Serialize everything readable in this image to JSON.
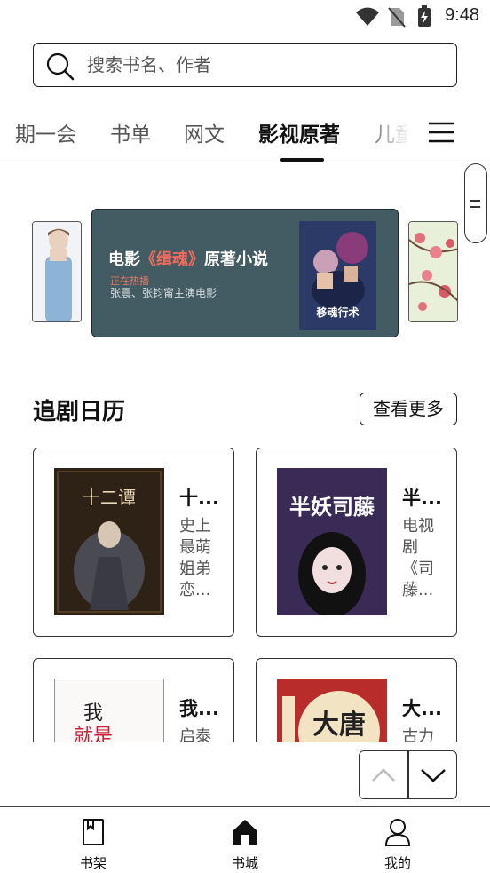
{
  "status_bar": {
    "time": "9:48",
    "icons": [
      "wifi-icon",
      "no-sim-icon",
      "battery-charging-icon"
    ]
  },
  "search": {
    "placeholder": "搜索书名、作者",
    "icon": "search-icon"
  },
  "tabs": [
    {
      "label": "期一会",
      "active": false
    },
    {
      "label": "书单",
      "active": false
    },
    {
      "label": "网文",
      "active": false
    },
    {
      "label": "影视原著",
      "active": true
    },
    {
      "label": "儿童",
      "active": false
    }
  ],
  "banner": {
    "title_prefix": "电影",
    "title_highlight": "《缉魂》",
    "title_suffix": "原著小说",
    "subtitle_1": "正在热播",
    "subtitle_2": "张震、张钧甯主演电影",
    "cover_title": "移魂行术",
    "highlight_color": "#f26b5b",
    "background_color": "#435b62"
  },
  "section": {
    "title": "追剧日历",
    "more_label": "查看更多"
  },
  "books": [
    {
      "title": "十...",
      "desc": "史上最萌姐弟恋...",
      "cover_text": "十二谭"
    },
    {
      "title": "半...",
      "desc": "电视剧《司藤...",
      "cover_text": "半妖司藤"
    },
    {
      "title": "我...",
      "desc": "启泰",
      "cover_text": "我就是"
    },
    {
      "title": "大...",
      "desc": "古力",
      "cover_text": "大唐"
    }
  ],
  "bottom_nav": [
    {
      "label": "书架",
      "icon": "bookshelf-icon"
    },
    {
      "label": "书城",
      "icon": "bookstore-home-icon"
    },
    {
      "label": "我的",
      "icon": "profile-icon"
    }
  ]
}
